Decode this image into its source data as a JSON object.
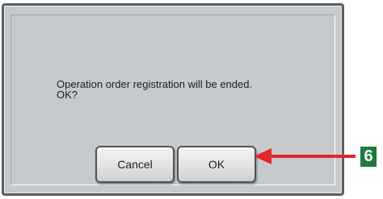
{
  "dialog": {
    "message_line1": "Operation order registration will be ended.",
    "message_line2": "OK?",
    "cancel_label": "Cancel",
    "ok_label": "OK"
  },
  "annotation": {
    "step_number": "6",
    "arrow_color": "#e3262d",
    "badge_color": "#1f7a3b"
  }
}
